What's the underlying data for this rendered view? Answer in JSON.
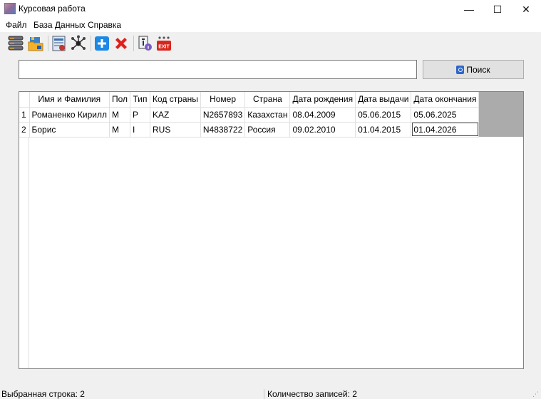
{
  "window": {
    "title": "Курсовая работа",
    "minimize_glyph": "—",
    "maximize_glyph": "☐",
    "close_glyph": "✕"
  },
  "menu": [
    "Файл",
    "База Данных",
    "Справка"
  ],
  "toolbar": {
    "buttons": [
      "database-stack-icon",
      "open-folder-icon",
      "table-report-icon",
      "network-graph-icon",
      "add-icon",
      "delete-icon",
      "info-icon",
      "exit-icon"
    ],
    "exit_label": "EXIT",
    "colors": {
      "add": "#1e88e5",
      "delete": "#e0201a",
      "exit": "#d9261c"
    }
  },
  "search": {
    "value": "",
    "button_label": "Поиск"
  },
  "grid": {
    "columns": [
      "",
      "Имя и Фамилия",
      "Пол",
      "Тип",
      "Код страны",
      "Номер",
      "Страна",
      "Дата рождения",
      "Дата выдачи",
      "Дата окончания"
    ],
    "rows": [
      [
        "1",
        "Романенко Кирилл",
        "М",
        "P",
        "KAZ",
        "N2657893",
        "Казахстан",
        "08.04.2009",
        "05.06.2015",
        "05.06.2025"
      ],
      [
        "2",
        "Борис",
        "М",
        "I",
        "RUS",
        "N4838722",
        "Россия",
        "09.02.2010",
        "01.04.2015",
        "01.04.2026"
      ]
    ]
  },
  "status": {
    "selected_row": "Выбранная строка: 2",
    "record_count": "Количество записей: 2"
  }
}
